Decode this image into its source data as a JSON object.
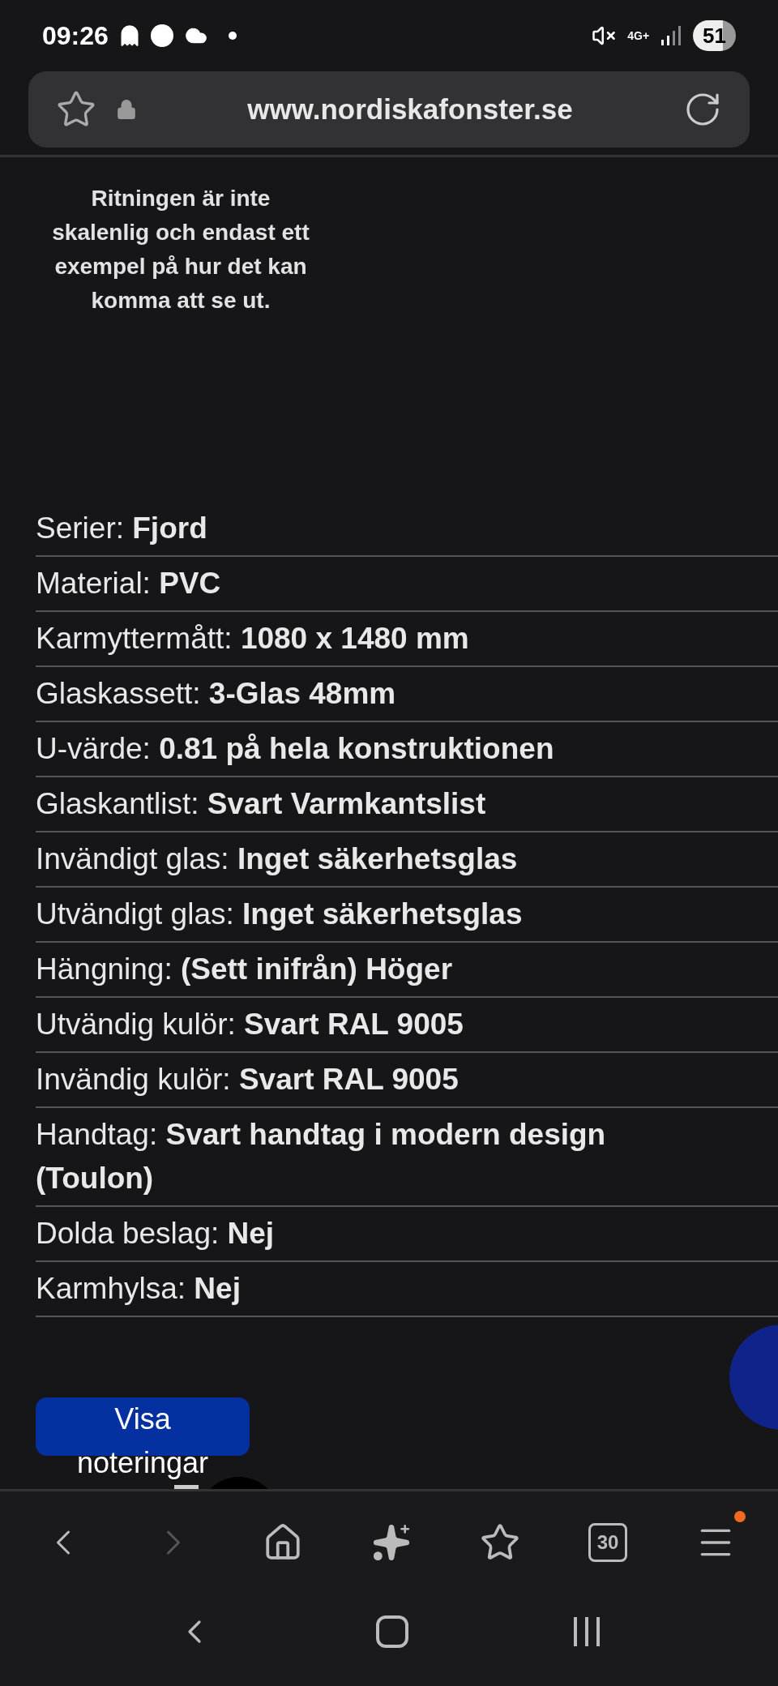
{
  "status_bar": {
    "time": "09:26",
    "network": "4G+",
    "battery": "51"
  },
  "address_bar": {
    "url": "www.nordiskafonster.se"
  },
  "drawing_note": "Ritningen är inte skalenlig och endast ett exempel på hur det kan komma att se ut.",
  "specs": [
    {
      "label": "Serier:",
      "value": "Fjord"
    },
    {
      "label": "Material:",
      "value": "PVC"
    },
    {
      "label": "Karmyttermått:",
      "value": "1080 x 1480 mm"
    },
    {
      "label": "Glaskassett:",
      "value": "3-Glas 48mm"
    },
    {
      "label": "U-värde:",
      "value": "0.81 på hela konstruktionen"
    },
    {
      "label": "Glaskantlist:",
      "value": "Svart Varmkantslist"
    },
    {
      "label": "Invändigt glas:",
      "value": "Inget säkerhetsglas"
    },
    {
      "label": "Utvändigt glas:",
      "value": "Inget säkerhetsglas"
    },
    {
      "label": "Hängning:",
      "value": "(Sett inifrån) Höger"
    },
    {
      "label": "Utvändig kulör:",
      "value": "Svart RAL 9005"
    },
    {
      "label": "Invändig kulör:",
      "value": "Svart RAL 9005"
    },
    {
      "label": "Handtag:",
      "value": "Svart handtag i modern design (Toulon)"
    },
    {
      "label": "Dolda beslag:",
      "value": "Nej"
    },
    {
      "label": "Karmhylsa:",
      "value": "Nej"
    }
  ],
  "notes_button": "Visa noteringar",
  "toolbar": {
    "tab_count": "30",
    "menu_badge": true,
    "forward_disabled": true
  }
}
